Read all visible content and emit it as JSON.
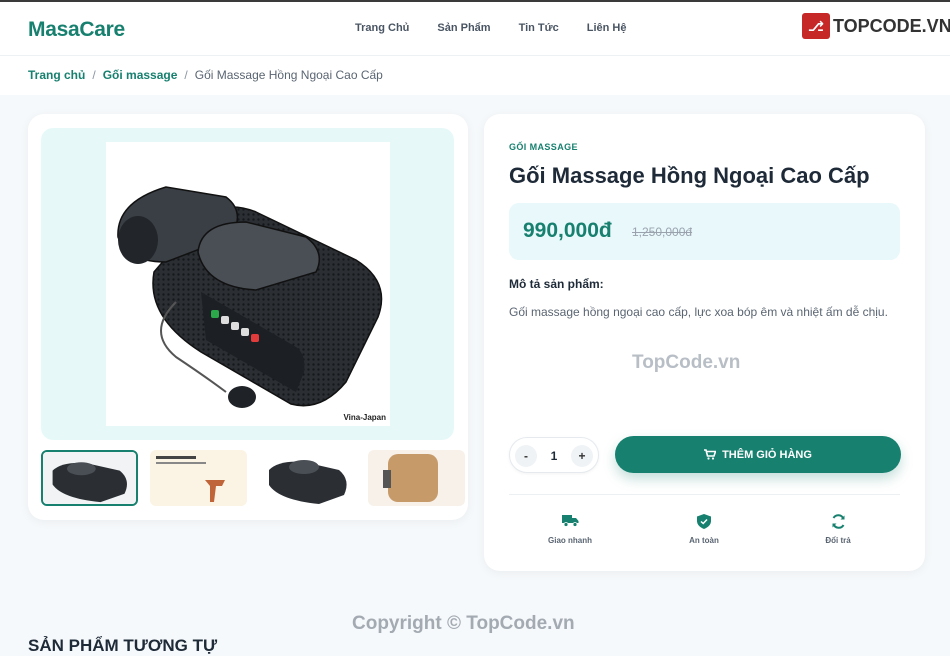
{
  "header": {
    "logo": "MasaCare",
    "nav": [
      "Trang Chủ",
      "Sản Phẩm",
      "Tin Tức",
      "Liên Hệ"
    ],
    "brand_badge": "TOPCODE.VN"
  },
  "breadcrumb": {
    "home": "Trang chủ",
    "category": "Gối massage",
    "current": "Gối Massage Hồng Ngoại Cao Cấp"
  },
  "gallery": {
    "main_caption": "Vina-Japan",
    "thumb_count": 4
  },
  "product": {
    "category": "GỐI MASSAGE",
    "title": "Gối Massage Hồng Ngoại Cao Cấp",
    "price": "990,000đ",
    "old_price": "1,250,000đ",
    "description_label": "Mô tả sản phẩm:",
    "description": "Gối massage hồng ngoại cao cấp, lực xoa bóp êm và nhiệt ấm dễ chịu.",
    "quantity": "1",
    "minus_label": "-",
    "plus_label": "+",
    "add_to_cart": "THÊM GIỎ HÀNG"
  },
  "features": [
    {
      "label": "Giao nhanh",
      "icon": "truck-icon"
    },
    {
      "label": "An toàn",
      "icon": "shield-icon"
    },
    {
      "label": "Đổi trả",
      "icon": "refresh-icon"
    }
  ],
  "watermark": "TopCode.vn",
  "copyright": "Copyright © TopCode.vn",
  "related_title": "SẢN PHẨM TƯƠNG TỰ",
  "colors": {
    "accent": "#17806f",
    "price_bg": "#e8f8fb",
    "gallery_bg": "#e6f9f8"
  }
}
